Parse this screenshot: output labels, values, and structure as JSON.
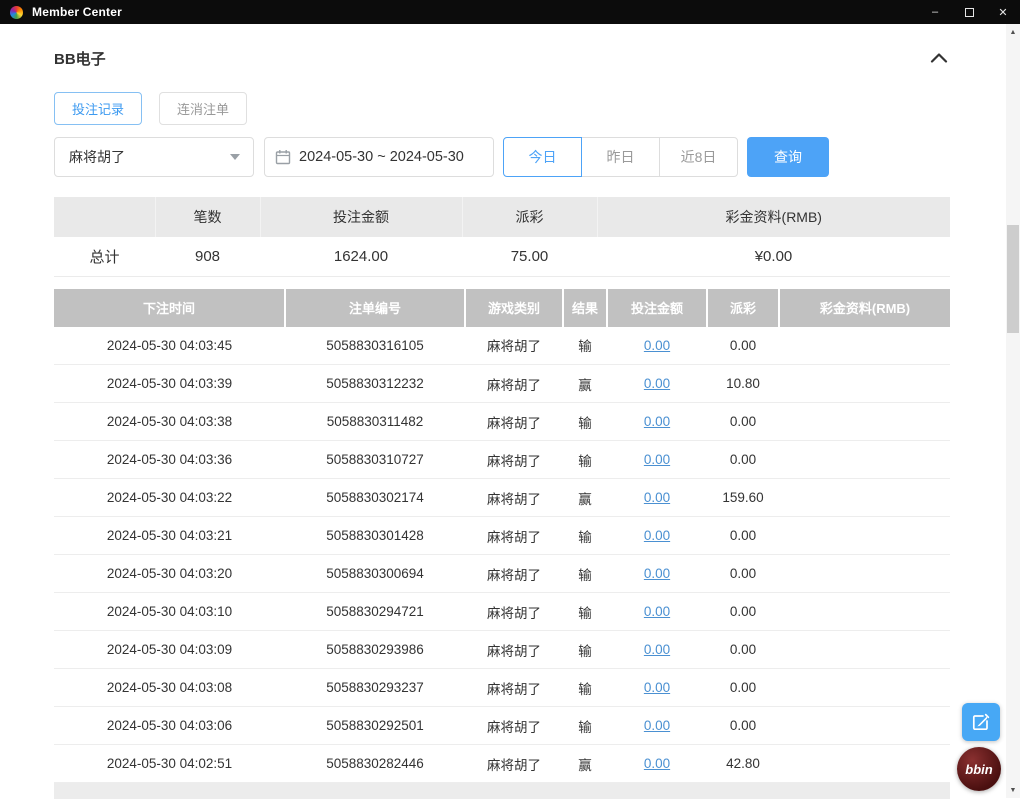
{
  "window": {
    "title": "Member Center"
  },
  "icons": {
    "minimize": "–",
    "close": "✕",
    "scroll_up": "▲",
    "scroll_down": "▼"
  },
  "section": {
    "title": "BB电子"
  },
  "tabs": [
    {
      "label": "投注记录",
      "active": true
    },
    {
      "label": "连消注单",
      "active": false
    }
  ],
  "filters": {
    "game_select_value": "麻将胡了",
    "date_range_value": "2024-05-30 ~ 2024-05-30",
    "quick_ranges": [
      {
        "label": "今日",
        "active": true
      },
      {
        "label": "昨日",
        "active": false
      },
      {
        "label": "近8日",
        "active": false
      }
    ],
    "search_label": "查询"
  },
  "summary": {
    "headers": [
      "笔数",
      "投注金额",
      "派彩",
      "彩金资料(RMB)"
    ],
    "row_label": "总计",
    "count": "908",
    "bet_amount": "1624.00",
    "payout": "75.00",
    "bonus": "¥0.00"
  },
  "detail_table": {
    "headers": [
      "下注时间",
      "注单编号",
      "游戏类别",
      "结果",
      "投注金额",
      "派彩",
      "彩金资料(RMB)"
    ],
    "rows": [
      {
        "time": "2024-05-30 04:03:45",
        "order": "5058830316105",
        "game": "麻将胡了",
        "result": "输",
        "bet": "0.00",
        "payout": "0.00",
        "bonus": ""
      },
      {
        "time": "2024-05-30 04:03:39",
        "order": "5058830312232",
        "game": "麻将胡了",
        "result": "赢",
        "bet": "0.00",
        "payout": "10.80",
        "bonus": ""
      },
      {
        "time": "2024-05-30 04:03:38",
        "order": "5058830311482",
        "game": "麻将胡了",
        "result": "输",
        "bet": "0.00",
        "payout": "0.00",
        "bonus": ""
      },
      {
        "time": "2024-05-30 04:03:36",
        "order": "5058830310727",
        "game": "麻将胡了",
        "result": "输",
        "bet": "0.00",
        "payout": "0.00",
        "bonus": ""
      },
      {
        "time": "2024-05-30 04:03:22",
        "order": "5058830302174",
        "game": "麻将胡了",
        "result": "赢",
        "bet": "0.00",
        "payout": "159.60",
        "bonus": ""
      },
      {
        "time": "2024-05-30 04:03:21",
        "order": "5058830301428",
        "game": "麻将胡了",
        "result": "输",
        "bet": "0.00",
        "payout": "0.00",
        "bonus": ""
      },
      {
        "time": "2024-05-30 04:03:20",
        "order": "5058830300694",
        "game": "麻将胡了",
        "result": "输",
        "bet": "0.00",
        "payout": "0.00",
        "bonus": ""
      },
      {
        "time": "2024-05-30 04:03:10",
        "order": "5058830294721",
        "game": "麻将胡了",
        "result": "输",
        "bet": "0.00",
        "payout": "0.00",
        "bonus": ""
      },
      {
        "time": "2024-05-30 04:03:09",
        "order": "5058830293986",
        "game": "麻将胡了",
        "result": "输",
        "bet": "0.00",
        "payout": "0.00",
        "bonus": ""
      },
      {
        "time": "2024-05-30 04:03:08",
        "order": "5058830293237",
        "game": "麻将胡了",
        "result": "输",
        "bet": "0.00",
        "payout": "0.00",
        "bonus": ""
      },
      {
        "time": "2024-05-30 04:03:06",
        "order": "5058830292501",
        "game": "麻将胡了",
        "result": "输",
        "bet": "0.00",
        "payout": "0.00",
        "bonus": ""
      },
      {
        "time": "2024-05-30 04:02:51",
        "order": "5058830282446",
        "game": "麻将胡了",
        "result": "赢",
        "bet": "0.00",
        "payout": "42.80",
        "bonus": ""
      }
    ]
  },
  "floating": {
    "bbin_label": "bbin"
  }
}
